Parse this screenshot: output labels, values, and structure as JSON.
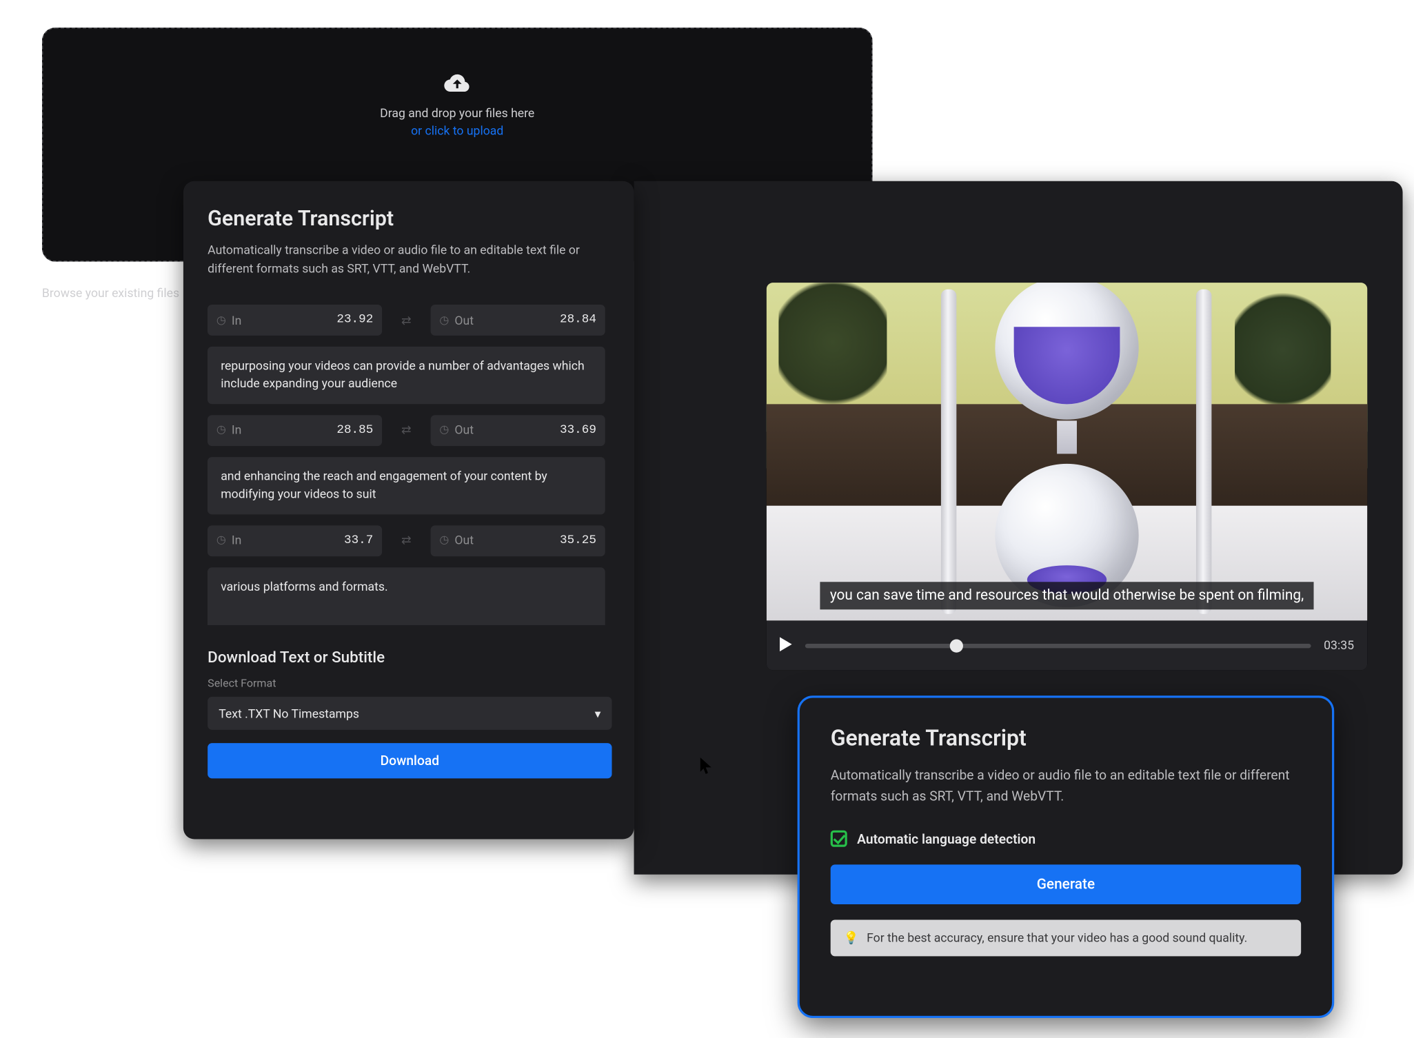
{
  "upload": {
    "drag_text": "Drag and drop your files here",
    "click_text": "or click to upload",
    "browse": "Browse your existing files"
  },
  "left": {
    "title": "Generate Transcript",
    "desc": "Automatically transcribe a video or audio file to an editable text file or different formats such as SRT, VTT, and WebVTT.",
    "segments": [
      {
        "in": "23.92",
        "out": "28.84",
        "text": "repurposing your videos can provide a number of advantages which include expanding your audience"
      },
      {
        "in": "28.85",
        "out": "33.69",
        "text": "and enhancing the reach and engagement of your content by modifying your videos to suit"
      },
      {
        "in": "33.7",
        "out": "35.25",
        "text": "various platforms and formats."
      }
    ],
    "in_label": "In",
    "out_label": "Out",
    "dl_title": "Download Text or Subtitle",
    "dl_label": "Select Format",
    "dl_selected": "Text .TXT No Timestamps",
    "dl_button": "Download"
  },
  "video": {
    "caption": "you can save time and resources that would otherwise be spent on filming,",
    "duration": "03:35"
  },
  "gen": {
    "title": "Generate Transcript",
    "desc": "Automatically transcribe a video or audio file to an editable text file or different formats such as SRT, VTT, and WebVTT.",
    "auto_label": "Automatic language detection",
    "button": "Generate",
    "tip": "For the best accuracy, ensure that your video has a good sound quality."
  }
}
